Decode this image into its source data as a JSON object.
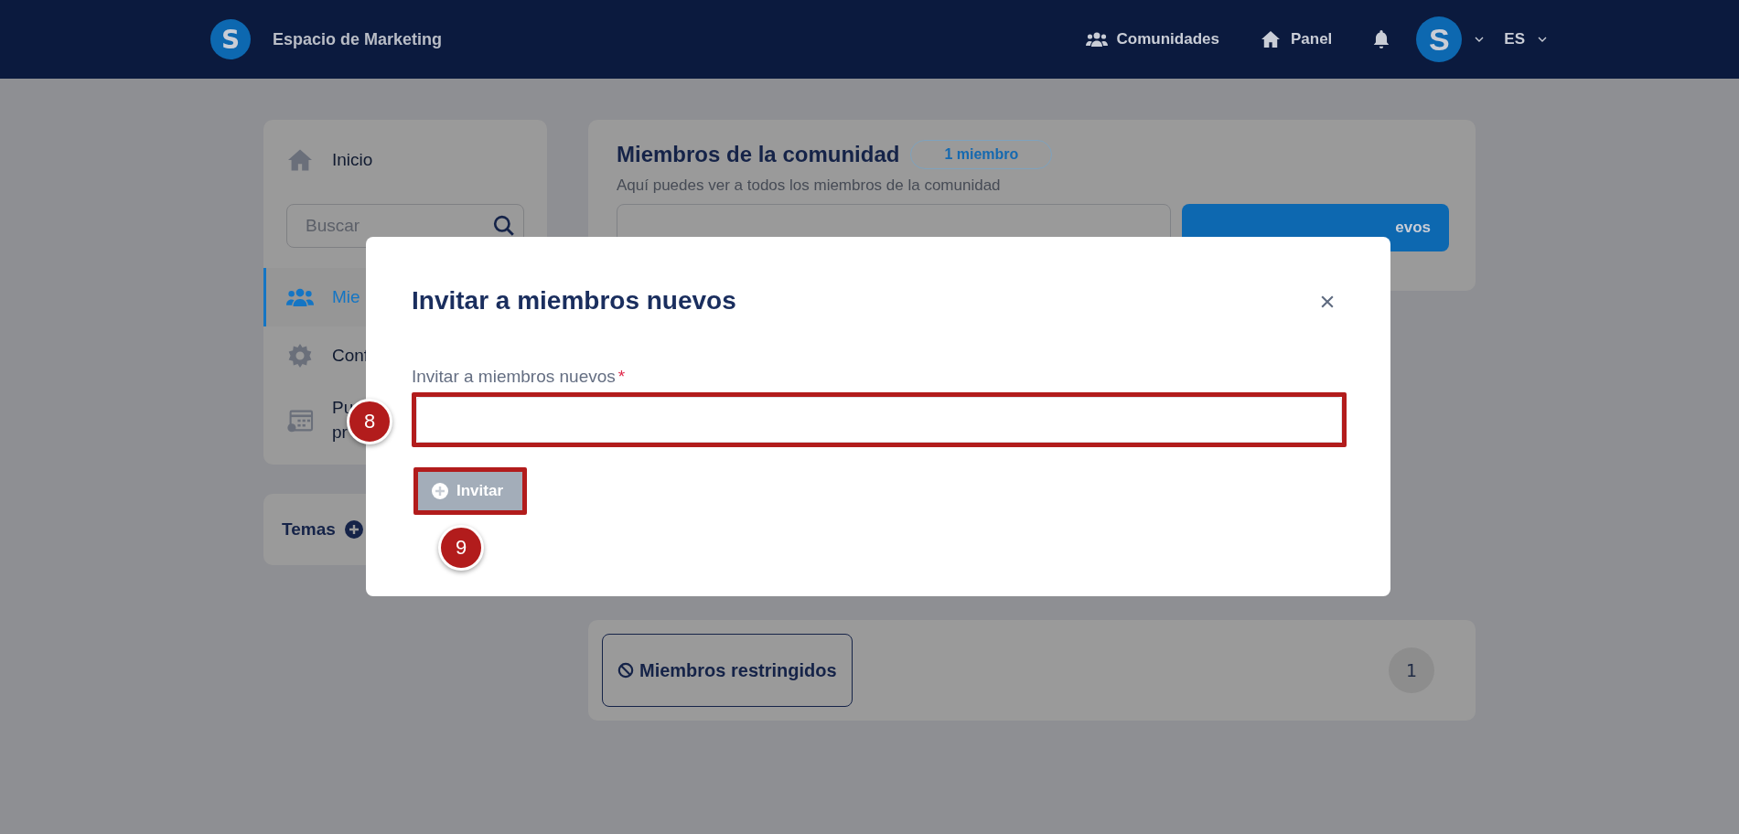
{
  "header": {
    "logo": "S",
    "title": "Espacio de Marketing",
    "nav": [
      {
        "label": "Comunidades",
        "kind": "people"
      },
      {
        "label": "Panel",
        "kind": "home"
      }
    ],
    "avatar": "S",
    "language": "ES"
  },
  "sidebar": {
    "items": [
      {
        "label": "Inicio",
        "selected": false
      }
    ],
    "search": {
      "placeholder": "Buscar"
    },
    "items2": [
      {
        "lines": [
          "Mie"
        ],
        "kind": "people",
        "selected": true
      },
      {
        "lines": [
          "Conf"
        ],
        "kind": "gear",
        "selected": false
      },
      {
        "lines": [
          "Pu",
          "pr"
        ],
        "kind": "calendar",
        "selected": false
      }
    ],
    "topics": {
      "label": "Temas"
    }
  },
  "members": {
    "title": "Miembros de la comunidad",
    "badge": "1 miembro",
    "subtitle": "Aquí puedes ver a todos los miembros de la comunidad",
    "button": "evos"
  },
  "restricted": {
    "label": "Miembros restringidos",
    "count": "1"
  },
  "modal": {
    "title": "Invitar a miembros nuevos",
    "field_label": "Invitar a miembros nuevos",
    "required_mark": "*",
    "button": "Invitar",
    "button_disabled": true
  },
  "annotations": [
    "8",
    "9"
  ]
}
